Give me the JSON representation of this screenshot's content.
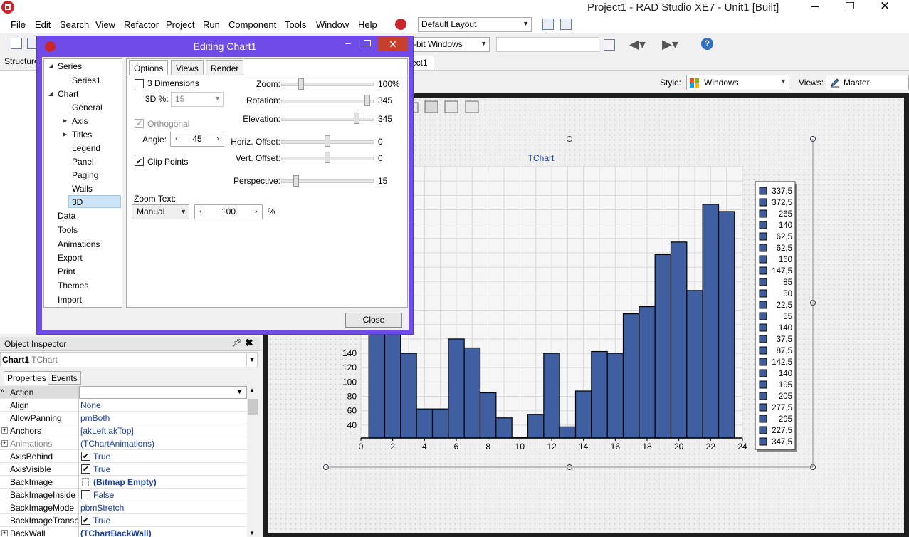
{
  "window": {
    "title": "Project1 - RAD Studio XE7 - Unit1 [Built]",
    "min": "–",
    "close": "✕"
  },
  "menu": [
    "File",
    "Edit",
    "Search",
    "View",
    "Refactor",
    "Project",
    "Run",
    "Component",
    "Tools",
    "Window",
    "Help"
  ],
  "layout_combo": "Default Layout",
  "platform_combo": "-bit Windows",
  "structure_label": "Structure",
  "unit_tab": "ect1",
  "designer": {
    "style_label": "Style:",
    "style_value": "Windows",
    "views_label": "Views:",
    "views_value": "Master"
  },
  "dialog": {
    "title": "Editing Chart1",
    "min": "–",
    "close_x": "✕",
    "tree": {
      "series": "Series",
      "series1": "Series1",
      "chart": "Chart",
      "general": "General",
      "axis": "Axis",
      "titles": "Titles",
      "legend": "Legend",
      "panel": "Panel",
      "paging": "Paging",
      "walls": "Walls",
      "three_d": "3D",
      "data": "Data",
      "tools": "Tools",
      "animations": "Animations",
      "export": "Export",
      "print": "Print",
      "themes": "Themes",
      "import": "Import"
    },
    "tabs": {
      "options": "Options",
      "views": "Views",
      "render": "Render"
    },
    "three_dimensions": "3 Dimensions",
    "three_d_pct_label": "3D %:",
    "three_d_pct_value": "15",
    "orthogonal": "Orthogonal",
    "angle_label": "Angle:",
    "angle_value": "45",
    "clip_points": "Clip Points",
    "zoom_text_label": "Zoom Text:",
    "zoom_text_mode": "Manual",
    "zoom_text_value": "100",
    "zoom_text_unit": "%",
    "zoom_label": "Zoom:",
    "zoom_value": "100%",
    "rotation_label": "Rotation:",
    "rotation_value": "345",
    "elevation_label": "Elevation:",
    "elevation_value": "345",
    "horiz_label": "Horiz. Offset:",
    "horiz_value": "0",
    "vert_label": "Vert. Offset:",
    "vert_value": "0",
    "perspective_label": "Perspective:",
    "perspective_value": "15",
    "close_button": "Close"
  },
  "inspector": {
    "title": "Object Inspector",
    "pin": "▼",
    "close": "✖",
    "object_name": "Chart1",
    "object_type": "TChart",
    "tabs": [
      "Properties",
      "Events"
    ],
    "rows": [
      {
        "name": "Action",
        "value": ""
      },
      {
        "name": "Align",
        "value": "None"
      },
      {
        "name": "AllowPanning",
        "value": "pmBoth"
      },
      {
        "name": "Anchors",
        "value": "[akLeft,akTop]"
      },
      {
        "name": "Animations",
        "value": "(TChartAnimations)"
      },
      {
        "name": "AxisBehind",
        "value": "True"
      },
      {
        "name": "AxisVisible",
        "value": "True"
      },
      {
        "name": "BackImage",
        "value": "(Bitmap Empty)"
      },
      {
        "name": "BackImageInside",
        "value": "False"
      },
      {
        "name": "BackImageMode",
        "value": "pbmStretch"
      },
      {
        "name": "BackImageTransp",
        "value": "True"
      },
      {
        "name": "BackWall",
        "value": "(TChartBackWall)"
      }
    ]
  },
  "chart_data": {
    "type": "bar",
    "title": "TChart",
    "x": [
      1,
      2,
      3,
      4,
      5,
      6,
      7,
      8,
      9,
      10,
      11,
      12,
      13,
      14,
      15,
      16,
      17,
      18,
      19,
      20,
      21,
      22,
      23
    ],
    "values": [
      337.5,
      372.5,
      140,
      62.5,
      62.5,
      160,
      147.5,
      85,
      50,
      22.5,
      55,
      140,
      37.5,
      87.5,
      142.5,
      140,
      195,
      205,
      277.5,
      295,
      227.5,
      347.5,
      337.5
    ],
    "xlim": [
      0,
      24
    ],
    "ylim": [
      22,
      400
    ],
    "x_ticks": [
      "0",
      "2",
      "4",
      "6",
      "8",
      "10",
      "12",
      "14",
      "16",
      "18",
      "20",
      "22",
      "24"
    ],
    "y_ticks": [
      "40",
      "60",
      "80",
      "100",
      "120",
      "140"
    ],
    "legend": [
      "337,5",
      "372,5",
      "265",
      "140",
      "62,5",
      "62,5",
      "160",
      "147,5",
      "85",
      "50",
      "22,5",
      "55",
      "140",
      "37,5",
      "87,5",
      "142,5",
      "140",
      "195",
      "205",
      "277,5",
      "295",
      "227,5",
      "347,5"
    ],
    "legend_position": "right",
    "grid": true,
    "bar_color": "#3f5fa0"
  }
}
